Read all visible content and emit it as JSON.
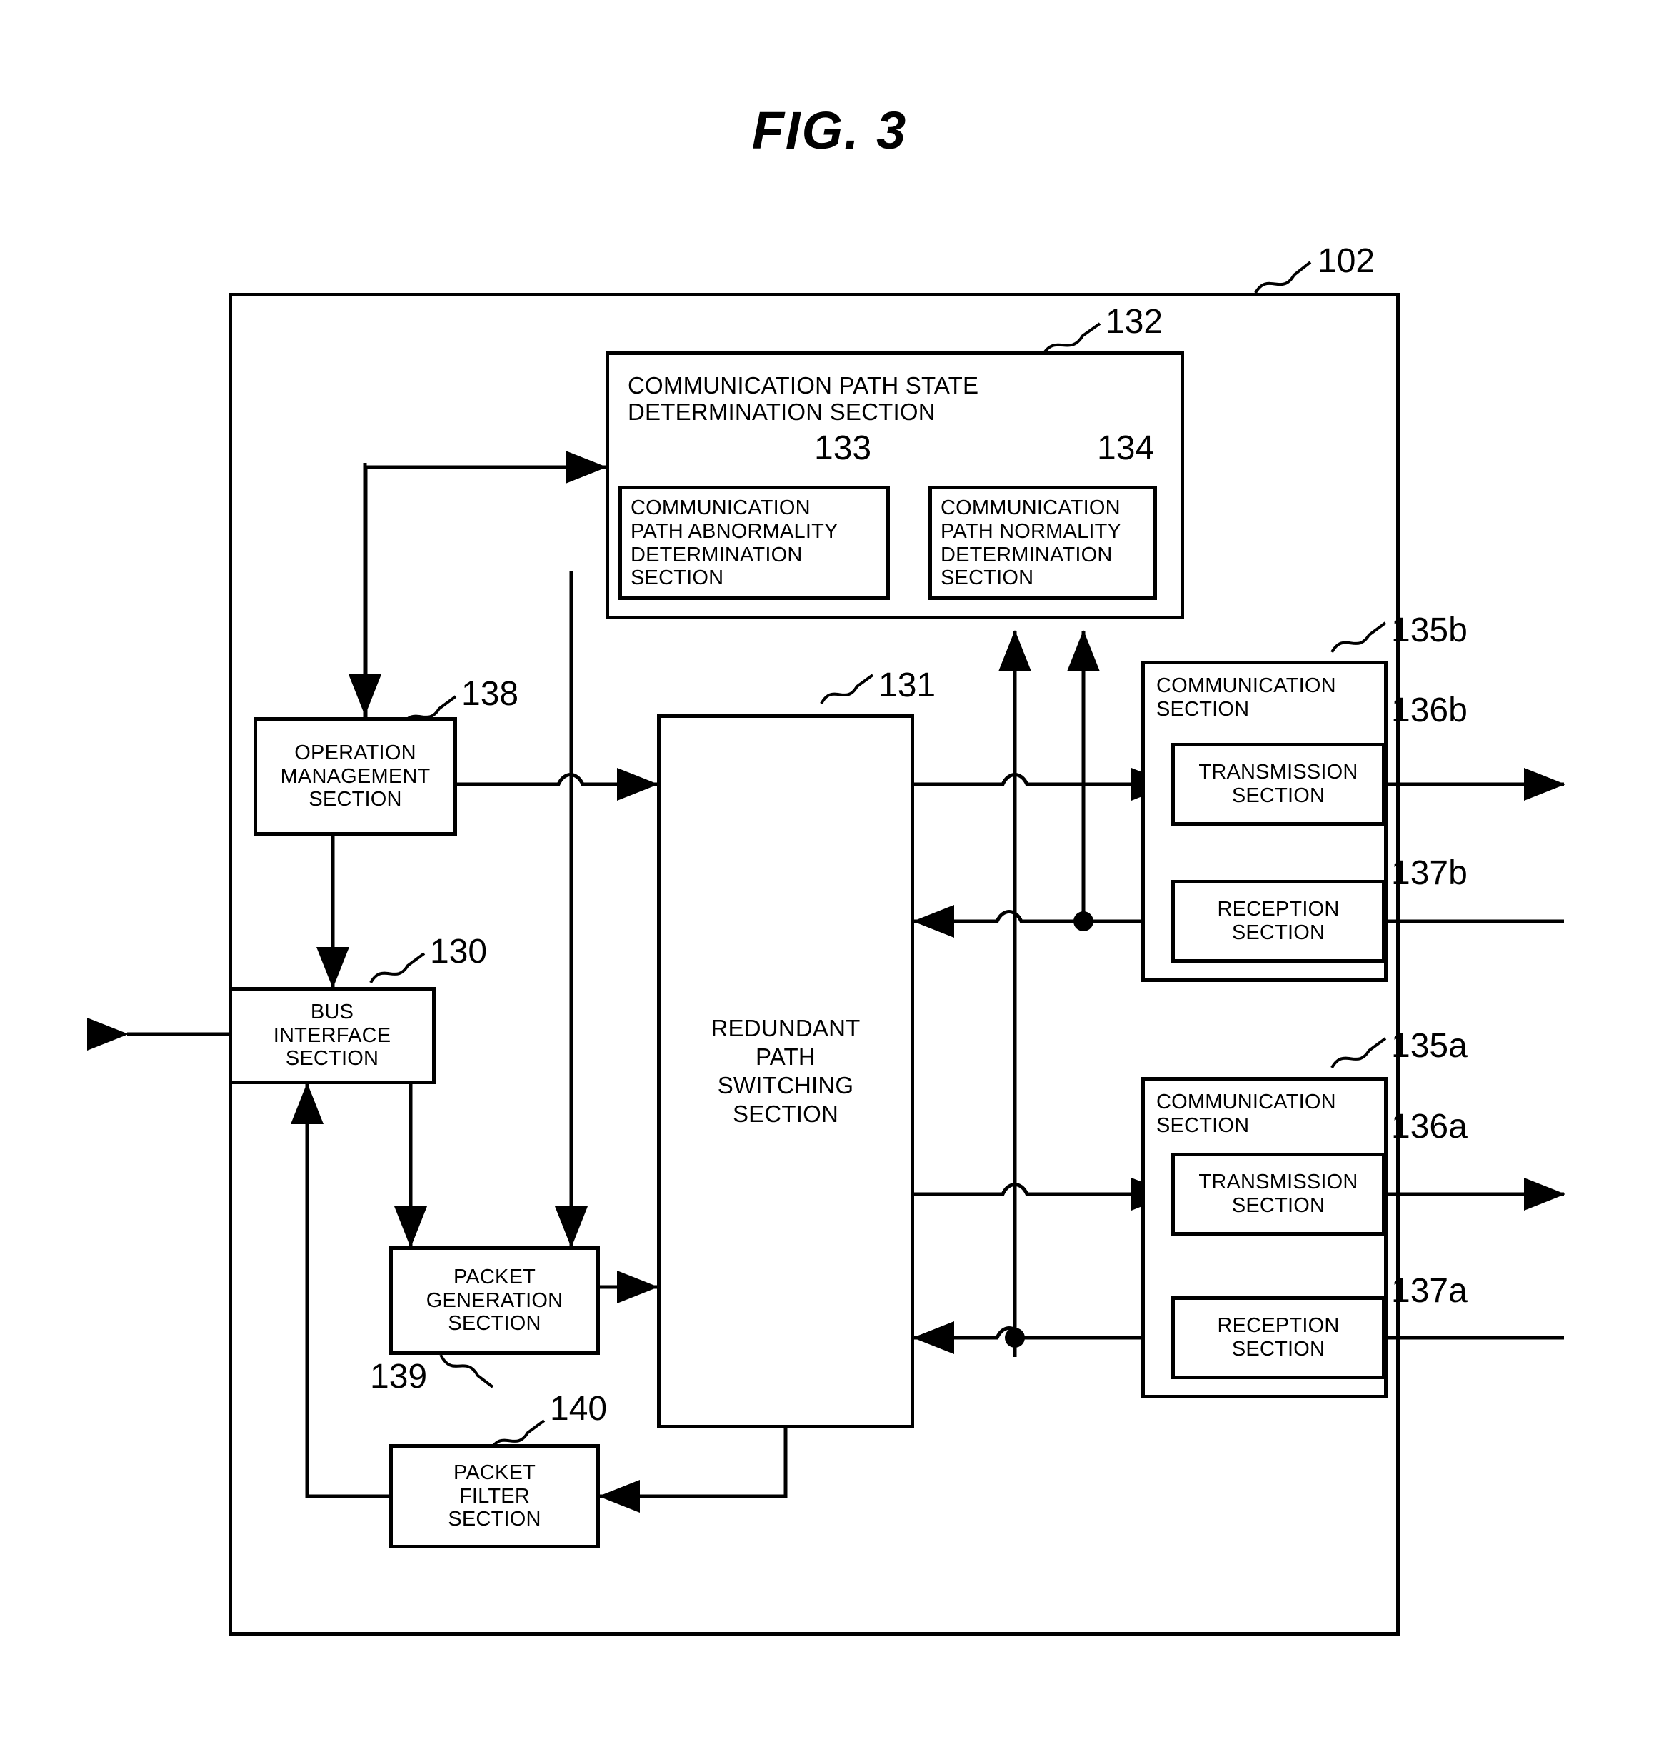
{
  "figure": {
    "title": "FIG. 3",
    "outer_ref": "102"
  },
  "blocks": {
    "comm_path_state": {
      "ref": "132",
      "label": "COMMUNICATION PATH STATE\nDETERMINATION SECTION",
      "label_line1": "COMMUNICATION PATH STATE",
      "label_line2": "DETERMINATION SECTION"
    },
    "abnormality": {
      "ref": "133",
      "label": "COMMUNICATION\nPATH ABNORMALITY\nDETERMINATION\nSECTION"
    },
    "normality": {
      "ref": "134",
      "label": "COMMUNICATION\nPATH NORMALITY\nDETERMINATION\nSECTION"
    },
    "operation_management": {
      "ref": "138",
      "label": "OPERATION\nMANAGEMENT\nSECTION"
    },
    "bus_interface": {
      "ref": "130",
      "label": "BUS\nINTERFACE\nSECTION"
    },
    "redundant_path": {
      "ref": "131",
      "label": "REDUNDANT\nPATH\nSWITCHING\nSECTION"
    },
    "packet_generation": {
      "ref": "139",
      "label": "PACKET\nGENERATION\nSECTION"
    },
    "packet_filter": {
      "ref": "140",
      "label": "PACKET\nFILTER\nSECTION"
    },
    "comm_section_b": {
      "ref": "135b",
      "label": "COMMUNICATION\nSECTION"
    },
    "transmission_b": {
      "ref": "136b",
      "label": "TRANSMISSION\nSECTION"
    },
    "reception_b": {
      "ref": "137b",
      "label": "RECEPTION\nSECTION"
    },
    "comm_section_a": {
      "ref": "135a",
      "label": "COMMUNICATION\nSECTION"
    },
    "transmission_a": {
      "ref": "136a",
      "label": "TRANSMISSION\nSECTION"
    },
    "reception_a": {
      "ref": "137a",
      "label": "RECEPTION\nSECTION"
    }
  },
  "colors": {
    "ink": "#000000",
    "paper": "#ffffff"
  }
}
